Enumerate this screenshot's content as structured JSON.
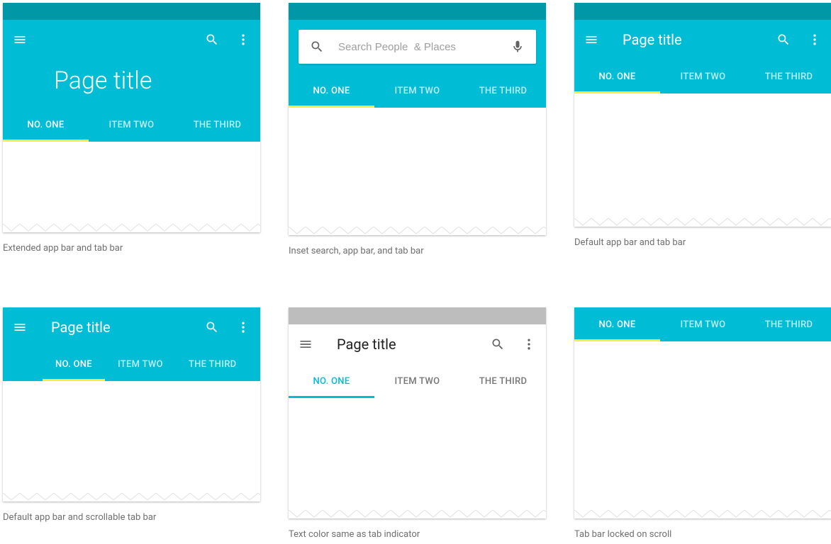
{
  "colors": {
    "primary": "#00bcd4",
    "primaryDark": "#0097a7",
    "accent": "#ffeb3b",
    "textOnPrimary": "#ffffff"
  },
  "tabs": [
    "NO. ONE",
    "ITEM TWO",
    "THE THIRD"
  ],
  "cards": [
    {
      "id": "extended",
      "title": "Page title",
      "caption": "Extended app bar and tab bar"
    },
    {
      "id": "inset-search",
      "searchPlaceholder": "Search People  & Places",
      "caption": "Inset search, app bar, and tab bar"
    },
    {
      "id": "default",
      "title": "Page title",
      "caption": "Default app bar and tab bar"
    },
    {
      "id": "scrollable",
      "title": "Page title",
      "caption": "Default app bar and scrollable tab bar"
    },
    {
      "id": "text-indicator",
      "title": "Page title",
      "caption": "Text color same as tab indicator"
    },
    {
      "id": "locked",
      "caption": "Tab bar locked on scroll"
    }
  ]
}
